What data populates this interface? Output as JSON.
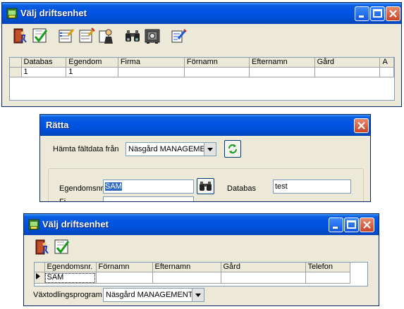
{
  "window1": {
    "title": "Välj driftsenhet",
    "toolbar_icons": [
      "exit-door-icon",
      "checkmark-icon",
      "edit-list-icon",
      "edit-list-2-icon",
      "person-card-icon",
      "binoculars-icon",
      "safe-icon",
      "edit-pen-icon"
    ],
    "grid": {
      "headers": [
        "",
        "Databas",
        "Egendom",
        "Firma",
        "Förnamn",
        "Efternamn",
        "Gård",
        "A"
      ],
      "rows": [
        [
          "",
          "1",
          "1",
          "",
          "",
          "",
          "",
          ""
        ]
      ]
    }
  },
  "dialog": {
    "title": "Rätta",
    "fetch_label": "Hämta fältdata från",
    "fetch_value": "Näsgård MANAGEME",
    "estate_label": "Egendomsnr.",
    "estate_value": "SAM",
    "database_label": "Databas",
    "database_value": "test",
    "partial_label": "Fi"
  },
  "window2": {
    "title": "Välj driftsenhet",
    "grid": {
      "headers": [
        "",
        "Egendomsnr.",
        "Förnamn",
        "Efternamn",
        "Gård",
        "Telefon"
      ],
      "rows": [
        [
          "",
          "SAM",
          "",
          "",
          "",
          ""
        ]
      ]
    },
    "program_label": "Växtodlingsprogram",
    "program_value": "Näsgård MANAGEMENT"
  }
}
